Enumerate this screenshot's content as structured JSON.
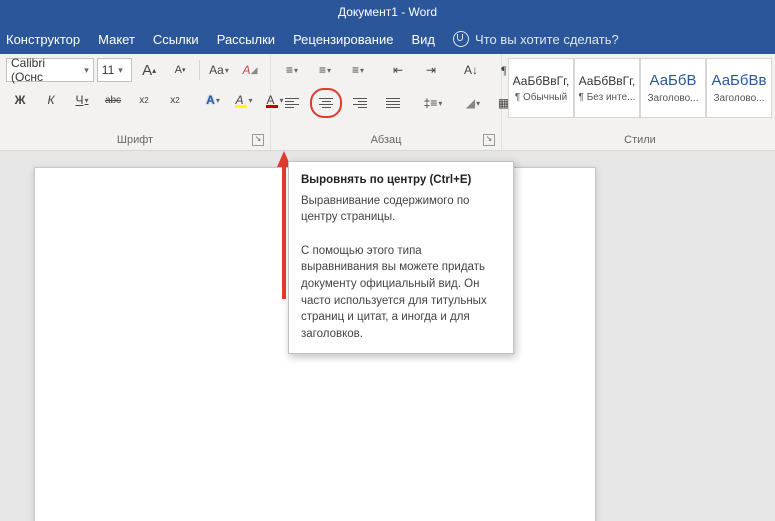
{
  "title": "Документ1  -  Word",
  "tabs": {
    "constructor": "Конструктор",
    "layout": "Макет",
    "links": "Ссылки",
    "mailings": "Рассылки",
    "review": "Рецензирование",
    "view": "Вид",
    "tellme": "Что вы хотите сделать?"
  },
  "font": {
    "name": "Calibri (Оснс",
    "size": "11",
    "inc": "A",
    "dec": "A",
    "case": "Aa",
    "clear": "A",
    "bold": "Ж",
    "italic": "К",
    "underline": "Ч",
    "strike": "abc",
    "sub": "x",
    "sup": "x",
    "texteffects": "A",
    "highlight": "A",
    "fontcolor": "A",
    "group_label": "Шрифт"
  },
  "para": {
    "group_label": "Абзац",
    "pilcrow": "¶"
  },
  "styles": {
    "group_label": "Стили",
    "items": [
      {
        "sample": "АаБбВвГг,",
        "name": "¶ Обычный"
      },
      {
        "sample": "АаБбВвГг,",
        "name": "¶ Без инте..."
      },
      {
        "sample": "АаБбВ",
        "name": "Заголово..."
      },
      {
        "sample": "АаБбВв",
        "name": "Заголово..."
      }
    ]
  },
  "tooltip": {
    "title": "Выровнять по центру (Ctrl+E)",
    "p1": "Выравнивание содержимого по центру страницы.",
    "p2": "С помощью этого типа выравнивания вы можете придать документу официальный вид. Он часто используется для титульных страниц и цитат, а иногда и для заголовков."
  }
}
